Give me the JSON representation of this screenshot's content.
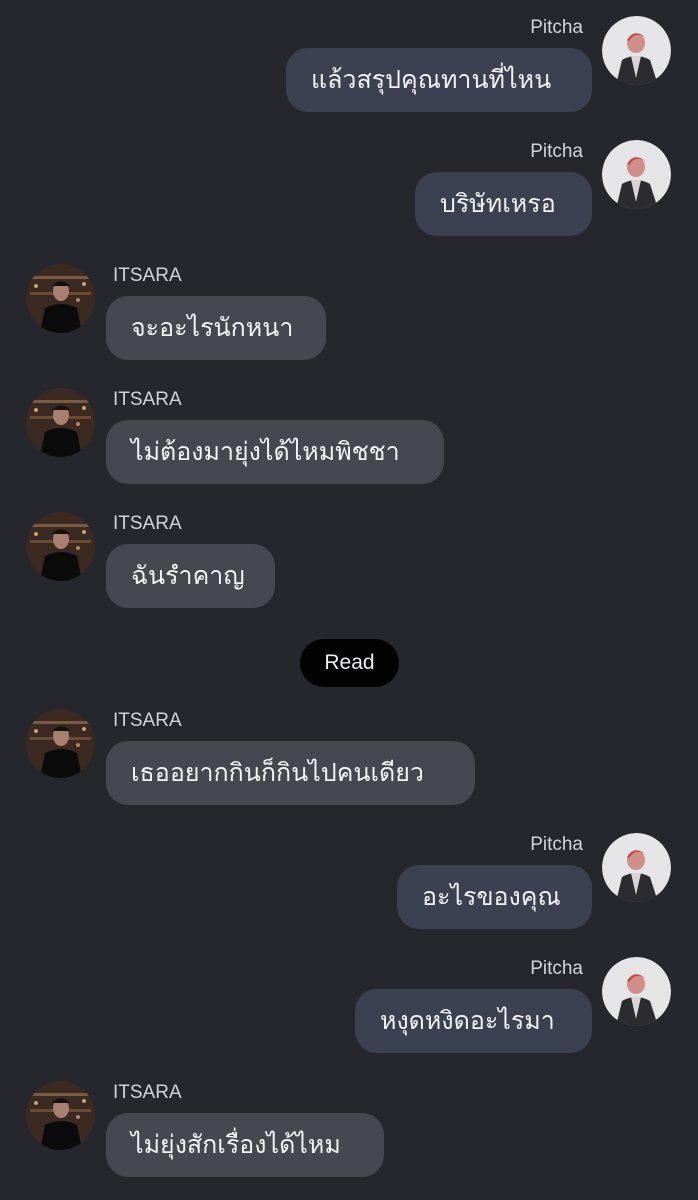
{
  "theme": {
    "background": "#26272d",
    "outgoing_bubble": "#3b4150",
    "incoming_bubble": "#47484f",
    "read_pill": "#020203"
  },
  "messages": [
    {
      "sender": "Pitcha",
      "direction": "outgoing",
      "text": "แล้วสรุปคุณทานที่ไหน"
    },
    {
      "sender": "Pitcha",
      "direction": "outgoing",
      "text": "บริษัทเหรอ"
    },
    {
      "sender": "ITSARA",
      "direction": "incoming",
      "text": "จะอะไรนักหนา"
    },
    {
      "sender": "ITSARA",
      "direction": "incoming",
      "text": "ไม่ต้องมายุ่งได้ไหมพิชชา"
    },
    {
      "sender": "ITSARA",
      "direction": "incoming",
      "text": "ฉันรำคาญ"
    },
    {
      "sender": "ITSARA",
      "direction": "incoming",
      "text": "เธออยากกินก็กินไปคนเดียว"
    },
    {
      "sender": "Pitcha",
      "direction": "outgoing",
      "text": "อะไรของคุณ"
    },
    {
      "sender": "Pitcha",
      "direction": "outgoing",
      "text": "หงุดหงิดอะไรมา"
    },
    {
      "sender": "ITSARA",
      "direction": "incoming",
      "text": "ไม่ยุ่งสักเรื่องได้ไหม"
    }
  ],
  "read_receipt": "Read",
  "avatars": {
    "Pitcha": "light-avatar-icon",
    "ITSARA": "dark-avatar-icon"
  }
}
